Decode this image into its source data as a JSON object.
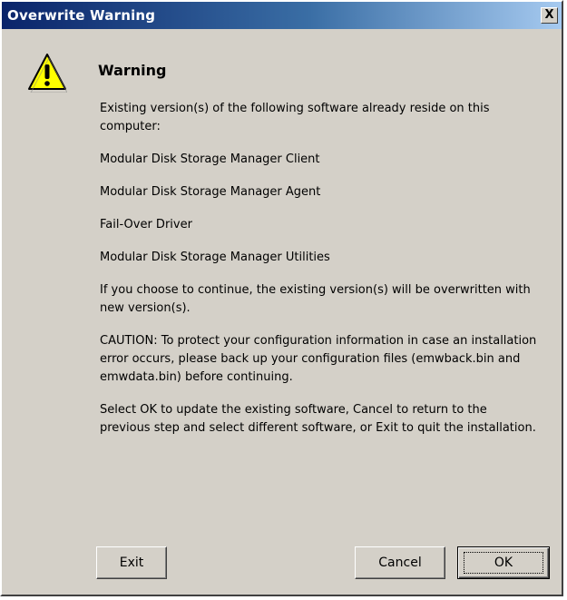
{
  "window": {
    "title": "Overwrite Warning",
    "close_label": "X"
  },
  "icon": "warning-triangle-icon",
  "heading": "Warning",
  "paragraphs": [
    "Existing version(s) of the following software already reside on this computer:",
    "Modular Disk Storage Manager Client",
    "Modular Disk Storage Manager Agent",
    "Fail-Over Driver",
    "Modular Disk Storage Manager Utilities",
    "If you choose to continue, the existing version(s) will be overwritten with new version(s).",
    "CAUTION: To protect your configuration information in case an installation error occurs, please back up your configuration files (emwback.bin and emwdata.bin) before continuing.",
    "Select OK to update the existing software, Cancel to return to the previous step and select different software, or Exit to quit the installation."
  ],
  "buttons": {
    "exit": "Exit",
    "cancel": "Cancel",
    "ok": "OK"
  },
  "colors": {
    "titlebar_start": "#0a246a",
    "titlebar_end": "#a6caf0",
    "dialog_background": "#d4d0c8",
    "warning_yellow": "#ffff00"
  }
}
